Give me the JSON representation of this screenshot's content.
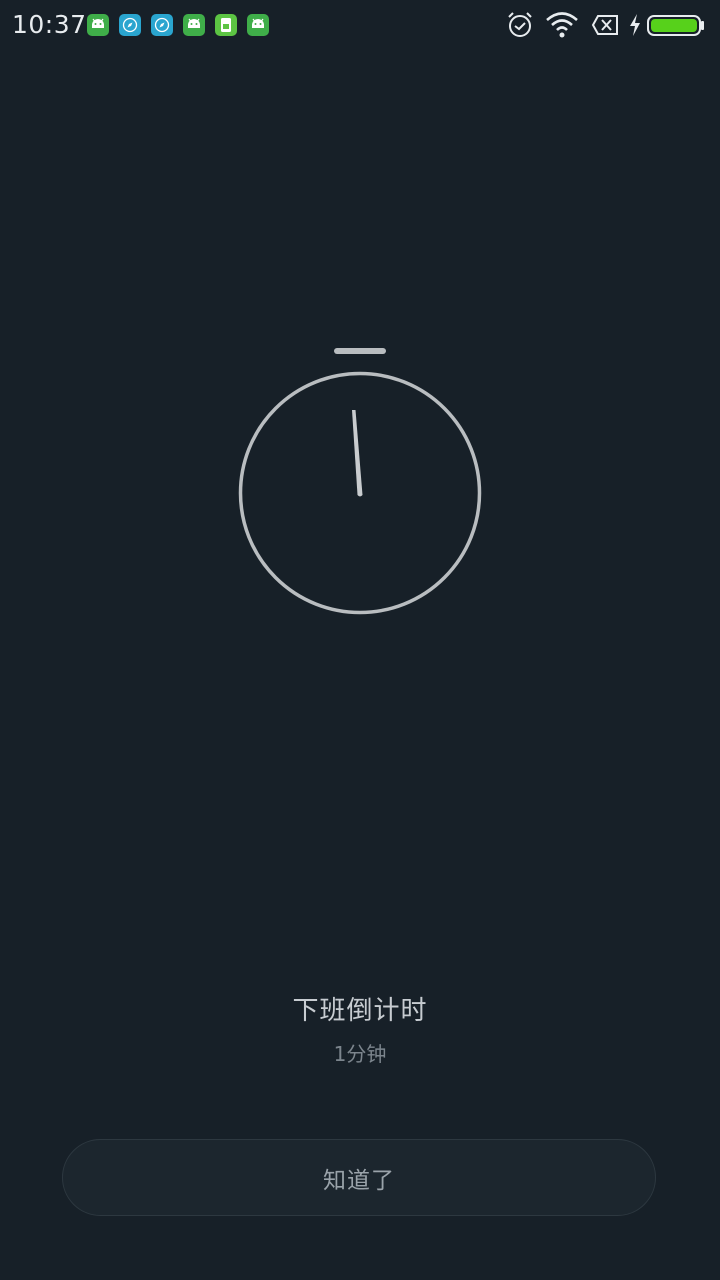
{
  "status_bar": {
    "time": "10:37",
    "notification_icons": [
      {
        "name": "android-app-icon",
        "color": "#3fae49"
      },
      {
        "name": "compass-app-icon",
        "color": "#2aa5cf"
      },
      {
        "name": "compass-app-icon",
        "color": "#2aa5cf"
      },
      {
        "name": "android-app-icon",
        "color": "#3fae49"
      },
      {
        "name": "sim-app-icon",
        "color": "#5cc443"
      },
      {
        "name": "android-app-icon",
        "color": "#3fae49"
      }
    ],
    "system_icons": [
      "alarm-icon",
      "wifi-icon",
      "no-sim-icon",
      "charging-icon",
      "battery-icon"
    ],
    "battery_level": 1.0,
    "battery_color": "#57d11b"
  },
  "timer": {
    "title": "下班倒计时",
    "duration": "1分钟"
  },
  "button": {
    "label": "知道了"
  },
  "colors": {
    "background": "#172028",
    "dial": "#b9bdc0",
    "hand": "#c9cccf"
  }
}
